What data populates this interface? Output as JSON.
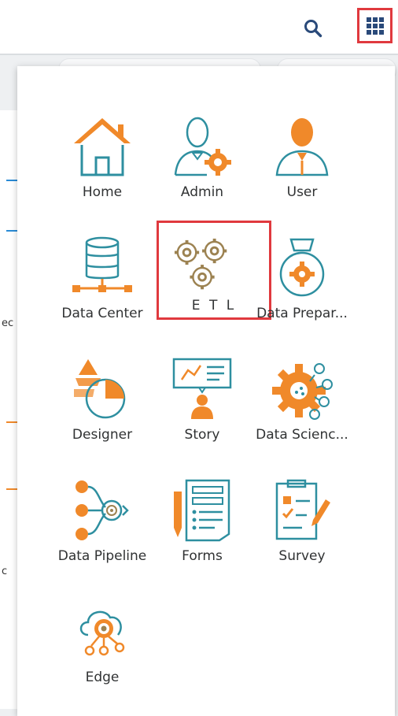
{
  "header": {
    "search_icon": "search-icon",
    "apps_icon": "grid-apps-icon"
  },
  "apps_menu": {
    "items": [
      {
        "label": "Home",
        "icon": "home-icon"
      },
      {
        "label": "Admin",
        "icon": "admin-icon"
      },
      {
        "label": "User",
        "icon": "user-icon"
      },
      {
        "label": "Data Center",
        "icon": "data-center-icon"
      },
      {
        "label": "E T L",
        "icon": "etl-gears-icon"
      },
      {
        "label": "Data Prepar...",
        "icon": "data-preparation-icon"
      },
      {
        "label": "Designer",
        "icon": "designer-icon"
      },
      {
        "label": "Story",
        "icon": "story-icon"
      },
      {
        "label": "Data Scienc...",
        "icon": "data-science-icon"
      },
      {
        "label": "Data Pipeline",
        "icon": "data-pipeline-icon"
      },
      {
        "label": "Forms",
        "icon": "forms-icon"
      },
      {
        "label": "Survey",
        "icon": "survey-icon"
      },
      {
        "label": "Edge",
        "icon": "edge-cloud-icon"
      }
    ]
  },
  "background_fragments": {
    "frag_1": "ec",
    "frag_2": "c"
  },
  "colors": {
    "accent_orange": "#f0892a",
    "outline_teal": "#2e8fa0",
    "gear_brown": "#9c8251",
    "highlight_red": "#e0393e",
    "icon_blue": "#2a4a7a"
  }
}
